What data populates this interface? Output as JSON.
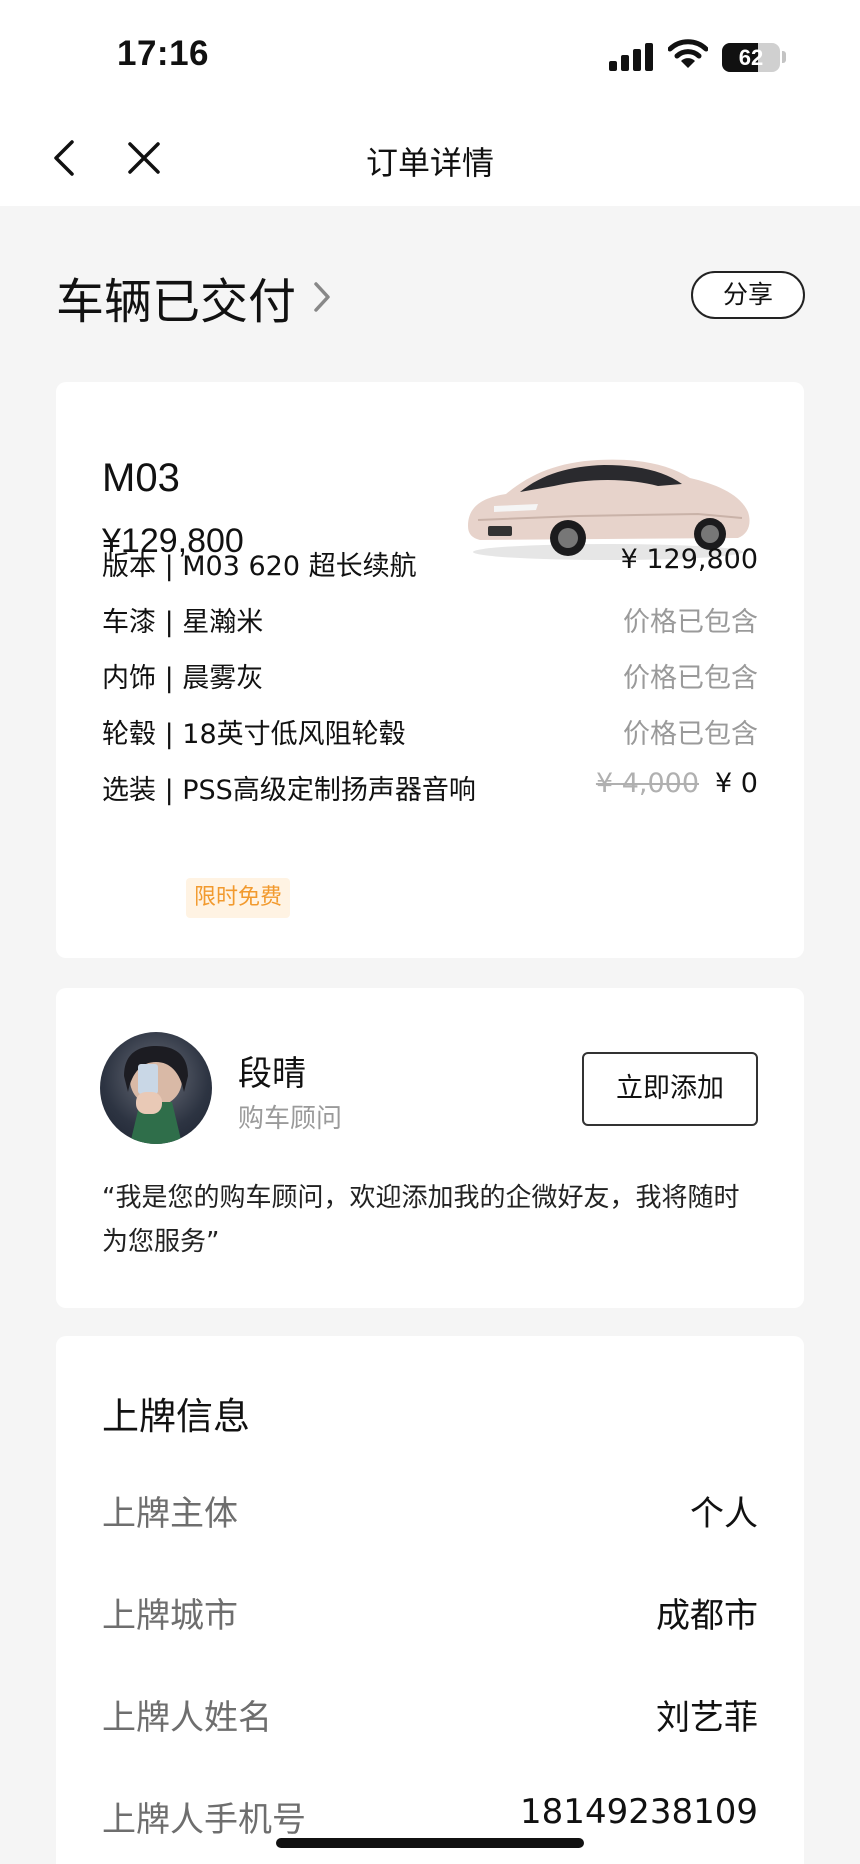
{
  "status_bar": {
    "time": "17:16",
    "battery": "62",
    "battery_level": 0.62
  },
  "nav": {
    "title": "订单详情"
  },
  "order_status": {
    "title": "车辆已交付",
    "share_label": "分享"
  },
  "vehicle": {
    "model": "M03",
    "price": "¥129,800",
    "specs": [
      {
        "label": "版本 | M03 620 超长续航",
        "value": "¥ 129,800",
        "muted": false
      },
      {
        "label": "车漆 | 星瀚米",
        "value": "价格已包含",
        "muted": true
      },
      {
        "label": "内饰 | 晨雾灰",
        "value": "价格已包含",
        "muted": true
      },
      {
        "label": "轮毂 | 18英寸低风阻轮毂",
        "value": "价格已包含",
        "muted": true
      },
      {
        "label": "选装 | PSS高级定制扬声器音响",
        "original_price": "¥ 4,000",
        "value": "¥ 0",
        "muted": false
      }
    ],
    "free_badge": "限时免费"
  },
  "advisor": {
    "name": "段晴",
    "role": "购车顾问",
    "add_label": "立即添加",
    "quote": "“我是您的购车顾问，欢迎添加我的企微好友，我将随时为您服务”"
  },
  "plate_info": {
    "title": "上牌信息",
    "rows": [
      {
        "label": "上牌主体",
        "value": "个人"
      },
      {
        "label": "上牌城市",
        "value": "成都市"
      },
      {
        "label": "上牌人姓名",
        "value": "刘艺菲"
      },
      {
        "label": "上牌人手机号",
        "value": "18149238109"
      }
    ]
  }
}
